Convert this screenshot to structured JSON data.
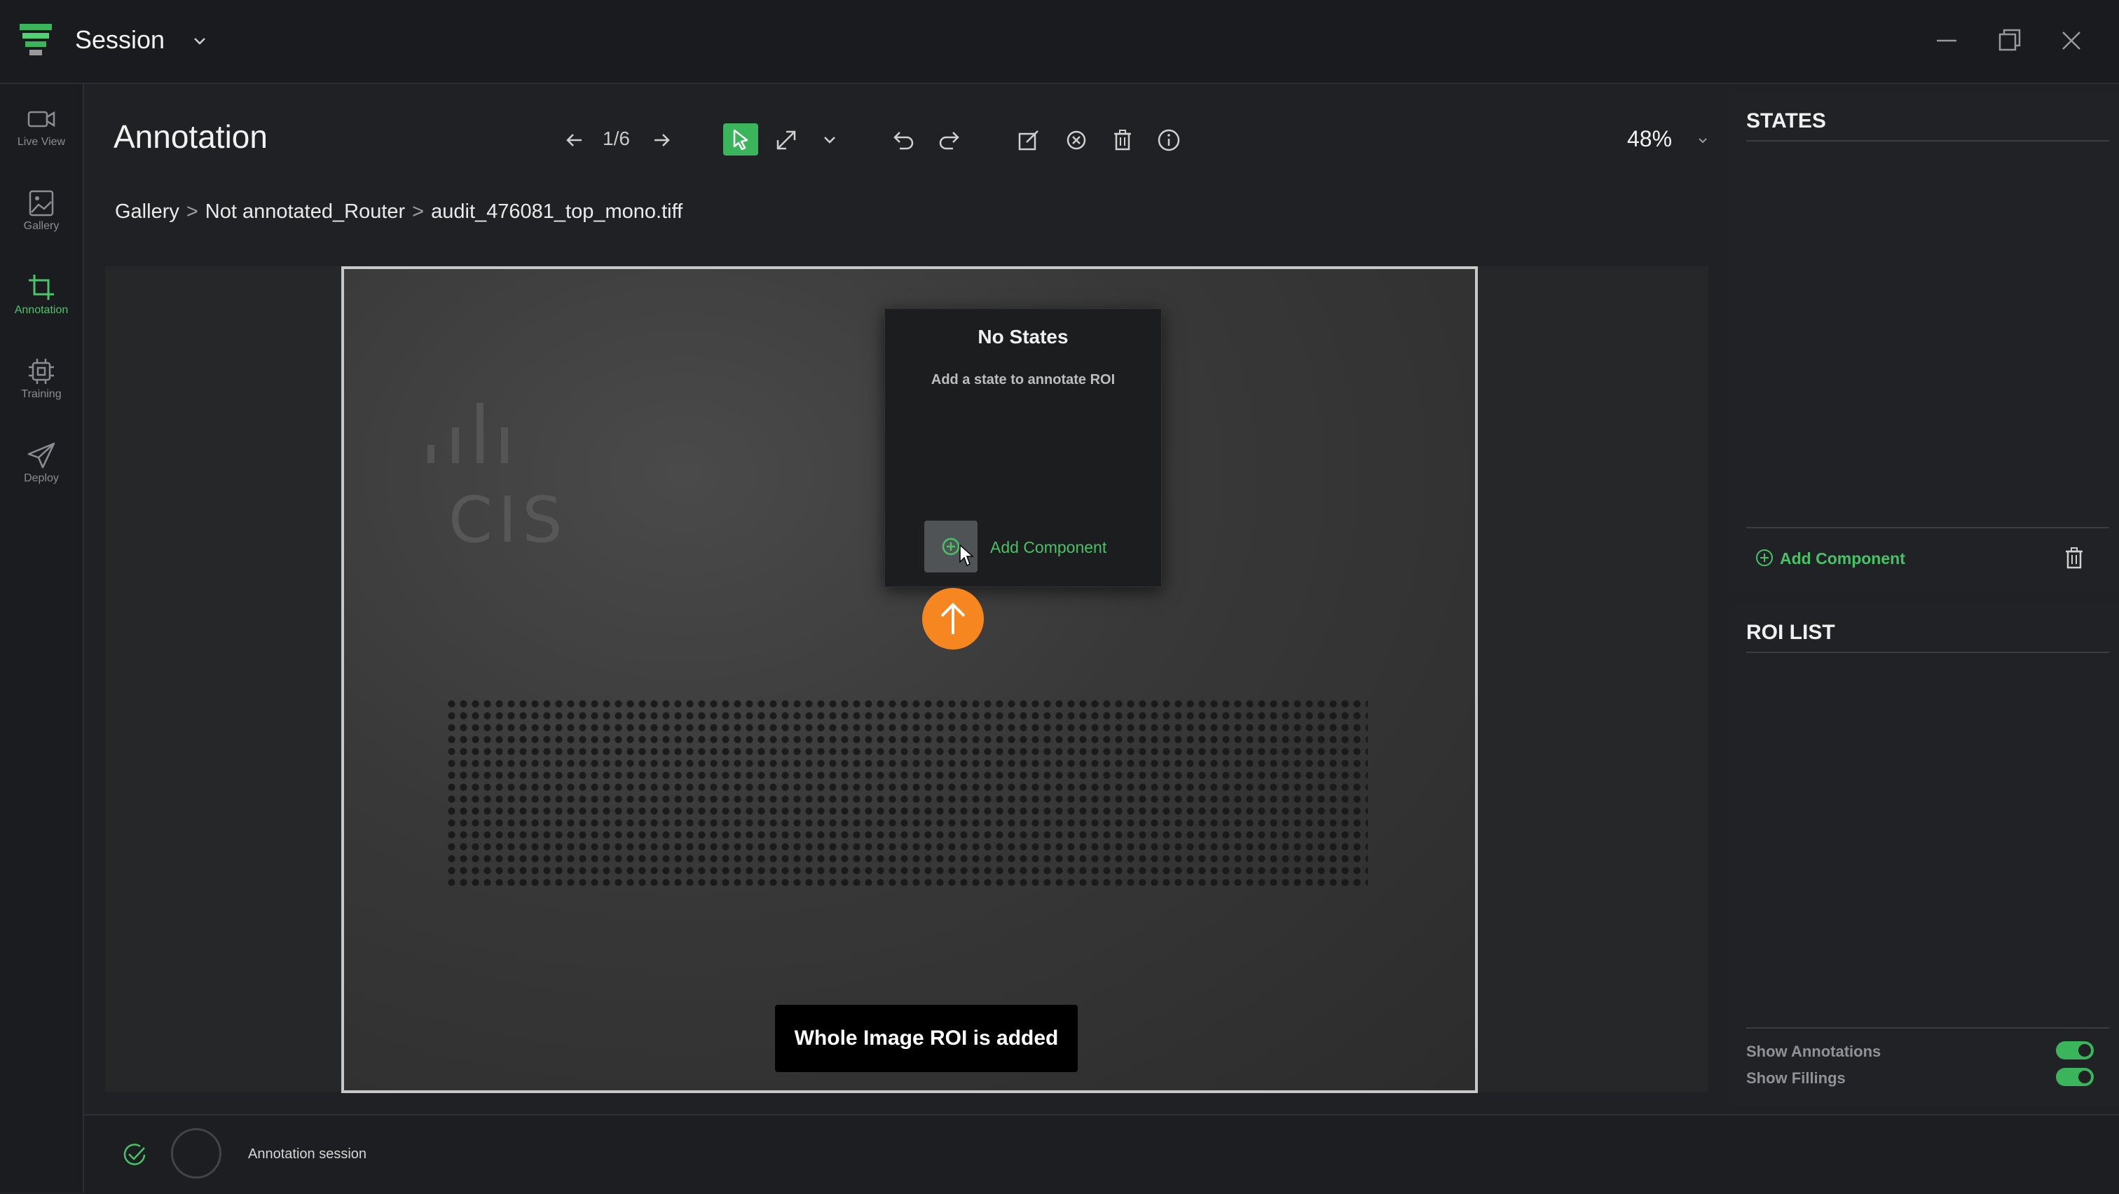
{
  "titlebar": {
    "title": "Session",
    "logo_icon": "layers-logo-icon",
    "window_controls": [
      "minimize-icon",
      "restore-icon",
      "close-icon"
    ]
  },
  "nav": {
    "items": [
      {
        "label": "Live View",
        "icon": "video-camera-icon",
        "active": false
      },
      {
        "label": "Gallery",
        "icon": "image-icon",
        "active": false
      },
      {
        "label": "Annotation",
        "icon": "crop-icon",
        "active": true
      },
      {
        "label": "Training",
        "icon": "chip-icon",
        "active": false
      },
      {
        "label": "Deploy",
        "icon": "send-icon",
        "active": false
      }
    ]
  },
  "header": {
    "title": "Annotation",
    "counter": "1/6",
    "zoom": "48%"
  },
  "breadcrumb": {
    "items": [
      "Gallery",
      "Not annotated_Router",
      "audit_476081_top_mono.tiff"
    ],
    "separator": ">"
  },
  "popup": {
    "title": "No States",
    "subtitle": "Add a state to annotate ROI",
    "add_label": "Add Component"
  },
  "toast": {
    "message": "Whole Image ROI is added"
  },
  "right_panel": {
    "states_heading": "STATES",
    "add_component_label": "Add Component",
    "roi_heading": "ROI LIST",
    "toggles": [
      {
        "label": "Show Annotations",
        "on": true
      },
      {
        "label": "Show Fillings",
        "on": true
      }
    ]
  },
  "status": {
    "text": "Annotation session"
  },
  "colors": {
    "accent": "#3bb55c",
    "accent_text": "#48c267",
    "orange": "#f6861f",
    "background": "#1f2124"
  }
}
